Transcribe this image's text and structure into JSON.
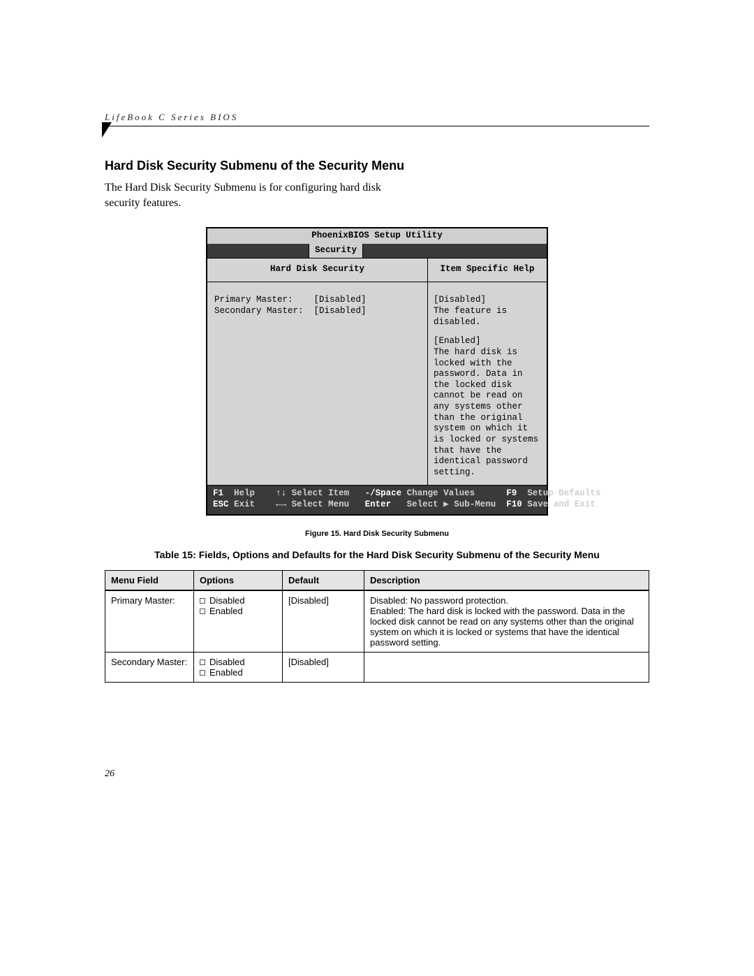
{
  "running_head": "LifeBook C Series BIOS",
  "section_title": "Hard Disk Security Submenu of the Security Menu",
  "body_text": "The Hard Disk Security Submenu is for configuring hard disk security features.",
  "bios": {
    "title": "PhoenixBIOS Setup Utility",
    "active_tab": "Security",
    "left_header": "Hard Disk Security",
    "right_header": "Item Specific Help",
    "fields": [
      {
        "label": "Primary Master:",
        "value": "[Disabled]"
      },
      {
        "label": "Secondary Master:",
        "value": "[Disabled]"
      }
    ],
    "help": {
      "disabled_label": "[Disabled]",
      "disabled_text": "The feature is disabled.",
      "enabled_label": "[Enabled]",
      "enabled_text": "The hard disk is locked with the password. Data in the locked disk cannot be read on any systems other than the original system on which it is locked or systems that have the identical password setting."
    },
    "footer": {
      "f1": "F1",
      "help": "Help",
      "updown": "↑↓",
      "select_item": "Select Item",
      "minus_space": "-/Space",
      "change_values": "Change Values",
      "f9": "F9",
      "setup_defaults": "Setup Defaults",
      "esc": "ESC",
      "exit": "Exit",
      "leftright": "←→",
      "select_menu": "Select Menu",
      "enter": "Enter",
      "select_submenu": "Select ▶ Sub-Menu",
      "f10": "F10",
      "save_exit": "Save and Exit"
    }
  },
  "figure_caption": "Figure 15.  Hard Disk Security Submenu",
  "table_title": "Table 15: Fields, Options and Defaults for the Hard Disk Security Submenu of the Security Menu",
  "table": {
    "headers": {
      "menu": "Menu Field",
      "options": "Options",
      "default": "Default",
      "description": "Description"
    },
    "rows": [
      {
        "menu": "Primary Master:",
        "options": [
          "Disabled",
          "Enabled"
        ],
        "default": "[Disabled]",
        "description": "Disabled: No password protection.\nEnabled: The hard disk is locked with the password. Data in the locked disk cannot be read on any systems other than the original system on which it is locked or systems that have the identical password setting."
      },
      {
        "menu": "Secondary Master:",
        "options": [
          "Disabled",
          "Enabled"
        ],
        "default": "[Disabled]",
        "description": ""
      }
    ]
  },
  "page_number": "26"
}
